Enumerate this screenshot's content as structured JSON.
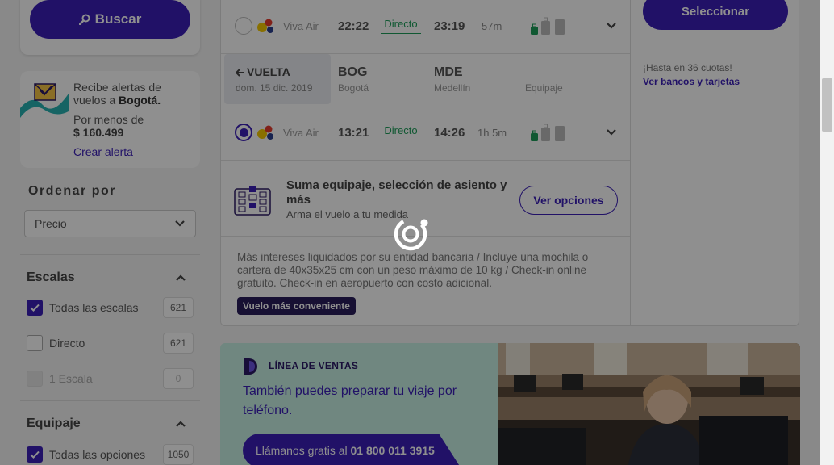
{
  "search": {
    "button_label": "Buscar",
    "icon": "search-icon"
  },
  "alert": {
    "text_prefix": "Recibe alertas de vuelos a ",
    "destination": "Bogotá.",
    "price_label": "Por menos de",
    "price": "$ 160.499",
    "link": "Crear alerta"
  },
  "sort": {
    "title": "Ordenar por",
    "selected": "Precio"
  },
  "filters": {
    "escalas": {
      "title": "Escalas",
      "options": [
        {
          "label": "Todas las escalas",
          "count": "621",
          "state": "checked"
        },
        {
          "label": "Directo",
          "count": "621",
          "state": "unchecked"
        },
        {
          "label": "1 Escala",
          "count": "0",
          "state": "disabled"
        }
      ]
    },
    "equipaje": {
      "title": "Equipaje",
      "options": [
        {
          "label": "Todas las opciones",
          "count": "1050",
          "state": "checked"
        }
      ]
    }
  },
  "flight": {
    "ida": {
      "airline": "Viva Air",
      "depart": "22:22",
      "stops": "Directo",
      "arrive": "23:19",
      "duration": "57m"
    },
    "vuelta": {
      "label": "VUELTA",
      "date": "dom. 15 dic. 2019",
      "origin_code": "BOG",
      "origin_city": "Bogotá",
      "dest_code": "MDE",
      "dest_city": "Medellín",
      "baggage_header": "Equipaje",
      "airline": "Viva Air",
      "depart": "13:21",
      "stops": "Directo",
      "arrive": "14:26",
      "duration": "1h 5m"
    },
    "extras": {
      "title": "Suma equipaje, selección de asiento y más",
      "subtitle": "Arma el vuelo a tu medida",
      "button": "Ver opciones"
    },
    "info": "Más intereses liquidados por su entidad bancaria / Incluye una mochila o cartera de 40x35x25 cm con un peso máximo de 10 kg / Check-in online gratuito. Check-in en aeropuerto con costo adicional.",
    "badge": "Vuelo más conveniente",
    "select_button": "Seleccionar",
    "installments": "¡Hasta en 36 cuotas!",
    "banks_link": "Ver bancos y tarjetas"
  },
  "sales": {
    "title": "LÍNEA DE VENTAS",
    "text": "También puedes preparar tu viaje por teléfono.",
    "call_prefix": "Llámanos gratis al ",
    "call_number": "01 800 011 3915"
  },
  "colors": {
    "brand": "#3b1fb8",
    "direct_green": "#1e9e5a",
    "banner_mint": "#c8f0e4",
    "badge_dark": "#2a1e5c"
  }
}
